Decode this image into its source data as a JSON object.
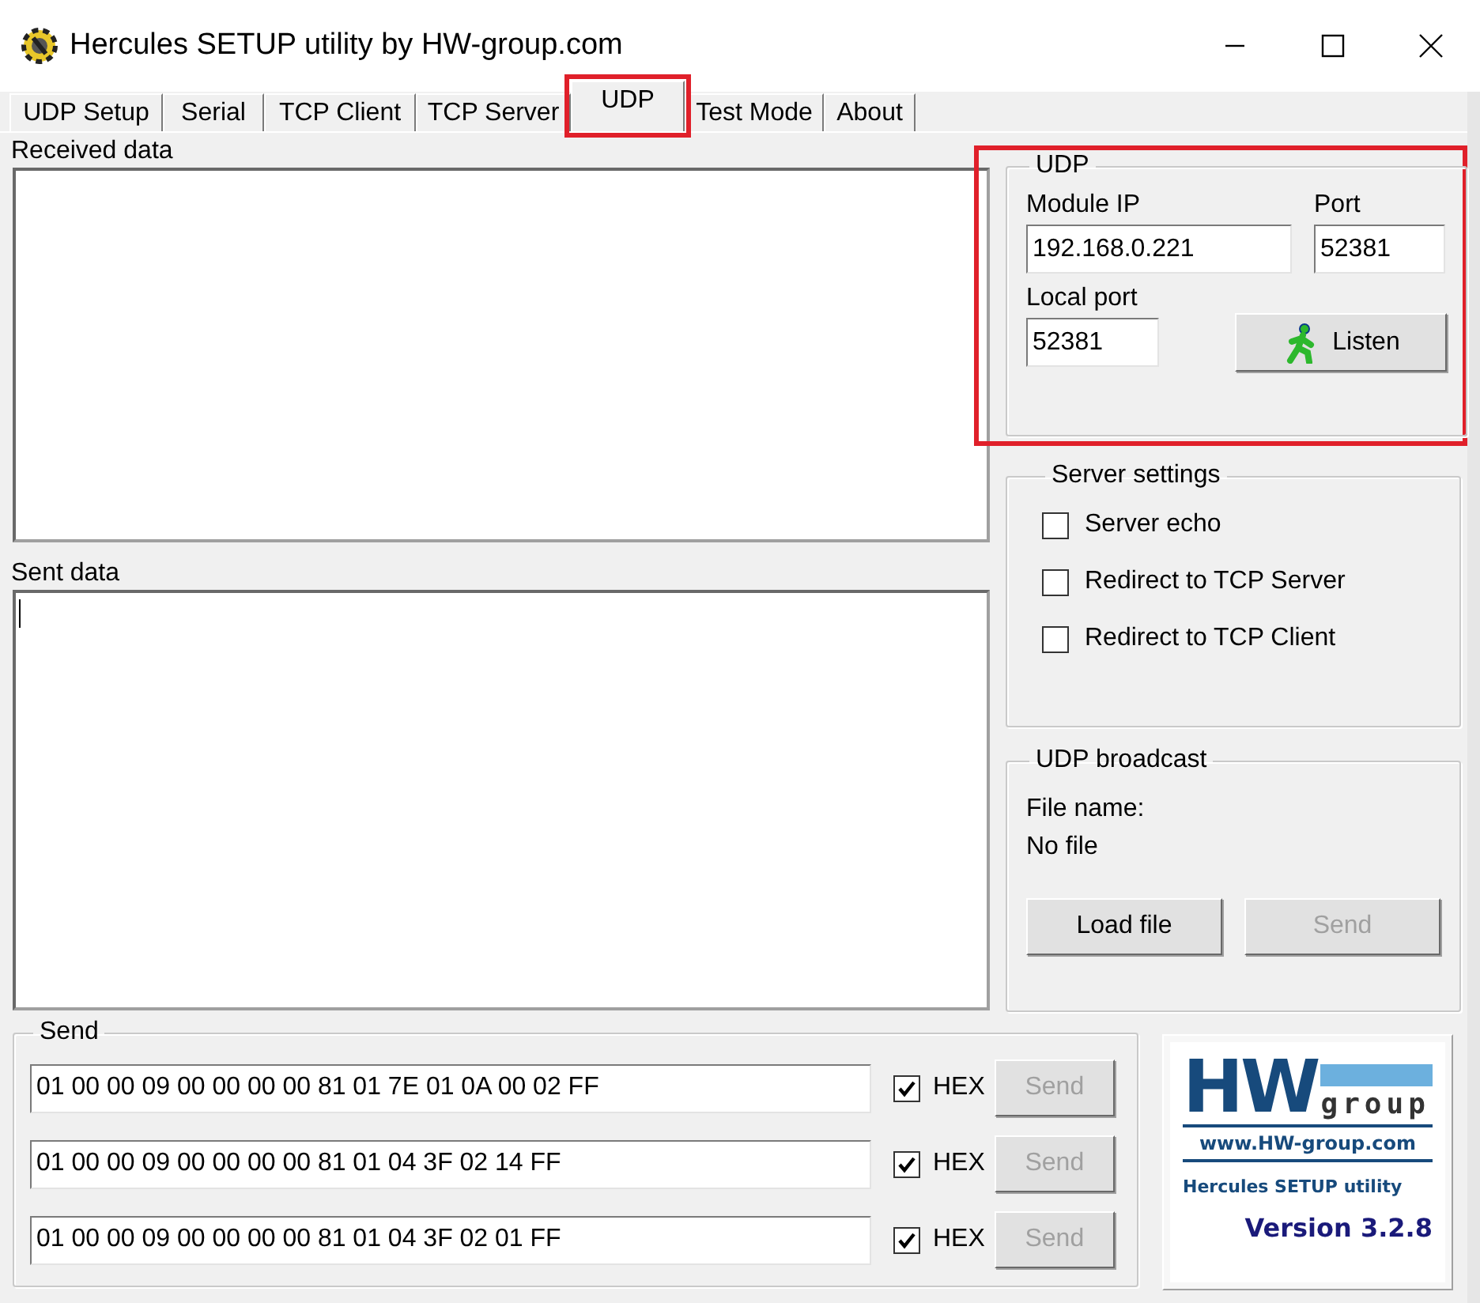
{
  "window": {
    "title": "Hercules SETUP utility by HW-group.com"
  },
  "tabs": [
    {
      "label": "UDP Setup",
      "selected": false,
      "highlighted": false
    },
    {
      "label": "Serial",
      "selected": false,
      "highlighted": false
    },
    {
      "label": "TCP Client",
      "selected": false,
      "highlighted": false
    },
    {
      "label": "TCP Server",
      "selected": false,
      "highlighted": false
    },
    {
      "label": "UDP",
      "selected": true,
      "highlighted": true
    },
    {
      "label": "Test Mode",
      "selected": false,
      "highlighted": false
    },
    {
      "label": "About",
      "selected": false,
      "highlighted": false
    }
  ],
  "received_data": {
    "label": "Received data"
  },
  "sent_data": {
    "label": "Sent data"
  },
  "udp": {
    "title": "UDP",
    "highlighted": true,
    "module_ip": {
      "label": "Module IP",
      "value": "192.168.0.221"
    },
    "port": {
      "label": "Port",
      "value": "52381"
    },
    "local_port": {
      "label": "Local port",
      "value": "52381"
    },
    "listen_button": {
      "label": "Listen"
    }
  },
  "server_settings": {
    "title": "Server settings",
    "options": [
      {
        "label": "Server echo",
        "checked": false
      },
      {
        "label": "Redirect to TCP Server",
        "checked": false
      },
      {
        "label": "Redirect to TCP Client",
        "checked": false
      }
    ]
  },
  "udp_broadcast": {
    "title": "UDP broadcast",
    "file_name_label": "File name:",
    "file_value": "No file",
    "buttons": [
      {
        "label": "Load file",
        "disabled": false
      },
      {
        "label": "Send",
        "disabled": true
      }
    ]
  },
  "send": {
    "title": "Send",
    "rows": [
      {
        "value": "01 00 00 09 00 00 00 00 81 01 7E 01 0A 00 02 FF",
        "hex": true,
        "hex_label": "HEX",
        "button": {
          "label": "Send",
          "disabled": true
        }
      },
      {
        "value": "01 00 00 09 00 00 00 00 81 01 04 3F 02 14 FF",
        "hex": true,
        "hex_label": "HEX",
        "button": {
          "label": "Send",
          "disabled": true
        }
      },
      {
        "value": "01 00 00 09 00 00 00 00 81 01 04 3F 02 01 FF",
        "hex": true,
        "hex_label": "HEX",
        "button": {
          "label": "Send",
          "disabled": true
        }
      }
    ]
  },
  "logo": {
    "brand_big": "HW",
    "brand_small": "group",
    "url": "www.HW-group.com",
    "product": "Hercules SETUP utility",
    "version": "Version 3.2.8"
  }
}
